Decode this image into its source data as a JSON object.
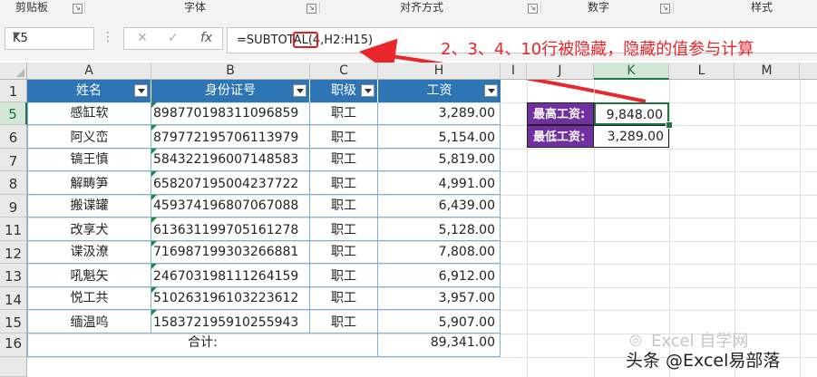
{
  "ribbon": {
    "groups": [
      "剪贴板",
      "字体",
      "对齐方式",
      "数字",
      "样式"
    ]
  },
  "formula_bar": {
    "name_box": "K5",
    "cancel_icon": "✕",
    "enter_icon": "✓",
    "fx_label": "fx",
    "formula": "=SUBTOTAL(4,H2:H15)"
  },
  "annotation": {
    "text": "2、3、4、10行被隐藏，隐藏的值参与计算",
    "color": "#e8262b"
  },
  "grid": {
    "columns": [
      "A",
      "B",
      "C",
      "H",
      "I",
      "J",
      "K",
      "L",
      "M"
    ],
    "selected_column": "K",
    "rows": [
      "1",
      "5",
      "6",
      "7",
      "8",
      "9",
      "11",
      "12",
      "13",
      "14",
      "15",
      "16"
    ],
    "selected_row": "5"
  },
  "table": {
    "headers": [
      "姓名",
      "身份证号",
      "职级",
      "工资"
    ],
    "header_color": "#2e75b6",
    "rows": [
      {
        "name": "感缸软",
        "id": "898770198311096859",
        "level": "职工",
        "salary": "3,289.00"
      },
      {
        "name": "阿义峦",
        "id": "879772195706113979",
        "level": "职工",
        "salary": "5,154.00"
      },
      {
        "name": "镐王慎",
        "id": "584322196007148583",
        "level": "职工",
        "salary": "5,819.00"
      },
      {
        "name": "解畴笋",
        "id": "658207195004237722",
        "level": "职工",
        "salary": "4,991.00"
      },
      {
        "name": "搬谍罐",
        "id": "459374196807067088",
        "level": "职工",
        "salary": "6,439.00"
      },
      {
        "name": "改享犬",
        "id": "613631199705161278",
        "level": "职工",
        "salary": "5,128.00"
      },
      {
        "name": "谍汲潦",
        "id": "716987199303266881",
        "level": "职工",
        "salary": "7,808.00"
      },
      {
        "name": "吼魁矢",
        "id": "246703198111264159",
        "level": "职工",
        "salary": "6,912.00"
      },
      {
        "name": "悦工共",
        "id": "510263196103223612",
        "level": "职工",
        "salary": "3,957.00"
      },
      {
        "name": "缅温呜",
        "id": "158372195910255943",
        "level": "职工",
        "salary": "5,907.00"
      }
    ],
    "total_label": "合计:",
    "total_value": "89,341.00"
  },
  "summary": {
    "max_label": "最高工资:",
    "max_value": "9,848.00",
    "min_label": "最低工资:",
    "min_value": "3,289.00",
    "label_color": "#7030a0"
  },
  "watermark": {
    "line1": "Excel 自学网",
    "line2": "头条 @Excel易部落"
  }
}
